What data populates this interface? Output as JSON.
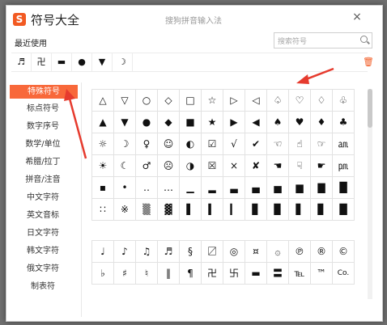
{
  "window": {
    "title": "符号大全",
    "ime_name": "搜狗拼音输入法",
    "logo_letter": "S",
    "close_glyph": "×",
    "brand_color": "#f25a22"
  },
  "recent": {
    "label": "最近使用",
    "symbols": [
      "♬",
      "卍",
      "▬",
      "●",
      "▼",
      "☽"
    ],
    "trash_glyph": "🗑"
  },
  "search": {
    "placeholder": "搜索符号"
  },
  "sidebar": {
    "items": [
      {
        "label": "特殊符号",
        "active": true
      },
      {
        "label": "标点符号",
        "active": false
      },
      {
        "label": "数字序号",
        "active": false
      },
      {
        "label": "数学/单位",
        "active": false
      },
      {
        "label": "希腊/拉丁",
        "active": false
      },
      {
        "label": "拼音/注音",
        "active": false
      },
      {
        "label": "中文字符",
        "active": false
      },
      {
        "label": "英文音标",
        "active": false
      },
      {
        "label": "日文字符",
        "active": false
      },
      {
        "label": "韩文字符",
        "active": false
      },
      {
        "label": "俄文字符",
        "active": false
      },
      {
        "label": "制表符",
        "active": false
      }
    ]
  },
  "grid1": [
    [
      "△",
      "▽",
      "○",
      "◇",
      "□",
      "☆",
      "▷",
      "◁",
      "♤",
      "♡",
      "♢",
      "♧"
    ],
    [
      "▲",
      "▼",
      "●",
      "◆",
      "■",
      "★",
      "▶",
      "◀",
      "♠",
      "♥",
      "♦",
      "♣"
    ],
    [
      "☼",
      "☽",
      "♀",
      "☺",
      "◐",
      "☑",
      "√",
      "✔",
      "☜",
      "☝",
      "☞",
      "㏂"
    ],
    [
      "☀",
      "☾",
      "♂",
      "☹",
      "◑",
      "☒",
      "×",
      "✘",
      "☚",
      "☟",
      "☛",
      "㏘"
    ],
    [
      "▪",
      "•",
      "‥",
      "…",
      "▁",
      "▂",
      "▃",
      "▄",
      "▅",
      "▆",
      "▇",
      "█"
    ],
    [
      "∷",
      "※",
      "▒",
      "▓",
      "▌",
      "▍",
      "▎",
      "▊",
      "▉",
      "▋",
      "▊",
      "█"
    ]
  ],
  "grid2": [
    [
      "♩",
      "♪",
      "♫",
      "♬",
      "§",
      "〼",
      "◎",
      "¤",
      "۞",
      "℗",
      "®",
      "©"
    ],
    [
      "♭",
      "♯",
      "♮",
      "‖",
      "¶",
      "卍",
      "卐",
      "▬",
      "〓",
      "℡",
      "™",
      "Co."
    ]
  ]
}
